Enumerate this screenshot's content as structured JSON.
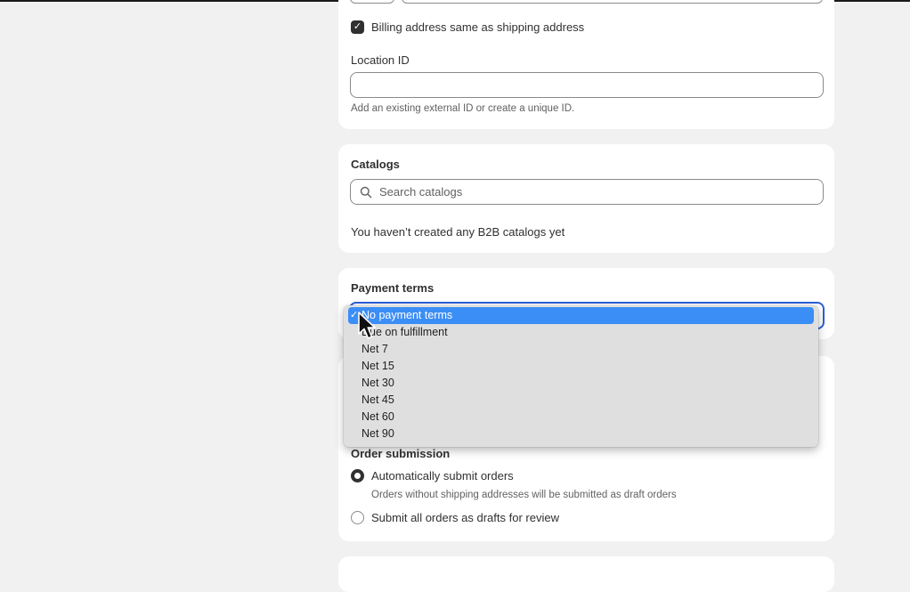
{
  "billing": {
    "same_as_shipping_label": "Billing address same as shipping address",
    "same_as_shipping_checked": true
  },
  "location": {
    "label": "Location ID",
    "value": "",
    "hint": "Add an existing external ID or create a unique ID."
  },
  "catalogs": {
    "heading": "Catalogs",
    "search_placeholder": "Search catalogs",
    "empty_text": "You haven’t created any B2B catalogs yet"
  },
  "payment_terms": {
    "heading": "Payment terms",
    "selected": "No payment terms",
    "options": [
      "No payment terms",
      "Due on fulfillment",
      "Net 7",
      "Net 15",
      "Net 30",
      "Net 45",
      "Net 60",
      "Net 90"
    ]
  },
  "order_submission": {
    "heading": "Order submission",
    "options": [
      {
        "label": "Automatically submit orders",
        "hint": "Orders without shipping addresses will be submitted as draft orders",
        "selected": true
      },
      {
        "label": "Submit all orders as drafts for review",
        "selected": false
      }
    ]
  },
  "icons": {
    "checkbox": "checkmark-icon",
    "search": "search-icon",
    "cursor": "mouse-pointer-icon"
  },
  "colors": {
    "page_bg": "#f1f1f1",
    "card_bg": "#ffffff",
    "focus_ring": "#2b5fd9",
    "option_highlight": "#3b8ef5",
    "dropdown_bg": "#dfdfdf"
  }
}
